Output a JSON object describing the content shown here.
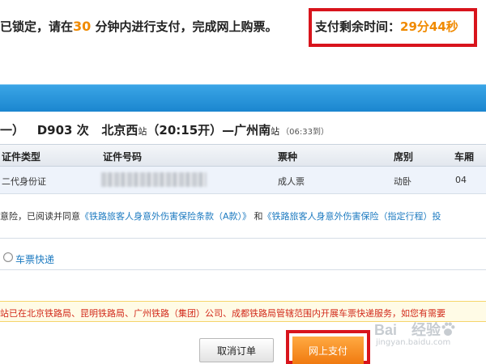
{
  "notice": {
    "prefix": "已锁定，请在",
    "minutes": "30",
    "suffix": "分钟内进行支付，完成网上购票。"
  },
  "timer": {
    "label": "支付剩余时间：",
    "value": "29分44秒"
  },
  "train": {
    "prefix": "一）",
    "number": "D903",
    "ci": "次",
    "from": "北京西",
    "from_suffix": "站",
    "depart": "（20:15开）",
    "dash": "—",
    "to": "广州南",
    "to_suffix": "站",
    "arrive": "（06:33到）"
  },
  "table": {
    "headers": [
      "证件类型",
      "证件号码",
      "票种",
      "席别",
      "车厢"
    ],
    "rows": [
      {
        "id_type": "二代身份证",
        "ticket_type": "成人票",
        "seat": "动卧",
        "car": "04"
      }
    ]
  },
  "insurance": {
    "prefix": "意险，已阅读并同意",
    "link1": "《铁路旅客人身意外伤害保险条款（A款）》",
    "and": "和",
    "link2": "《铁路旅客人身意外伤害保险（指定行程）投"
  },
  "express": {
    "label": "车票快递"
  },
  "yellow_notice": "站已在北京铁路局、昆明铁路局、广州铁路（集团）公司、成都铁路局管辖范围内开展车票快递服务，如您有需要",
  "buttons": {
    "cancel": "取消订单",
    "pay": "网上支付"
  },
  "watermark": {
    "logo": "Bai",
    "logo_tail": "经验",
    "site": "jingyan.baidu.com"
  },
  "colors": {
    "highlight": "#f08a00",
    "callout_border": "#d8141c",
    "band": "#1b86cf",
    "link": "#1c7ac0",
    "pay_button": "#f07a10"
  }
}
